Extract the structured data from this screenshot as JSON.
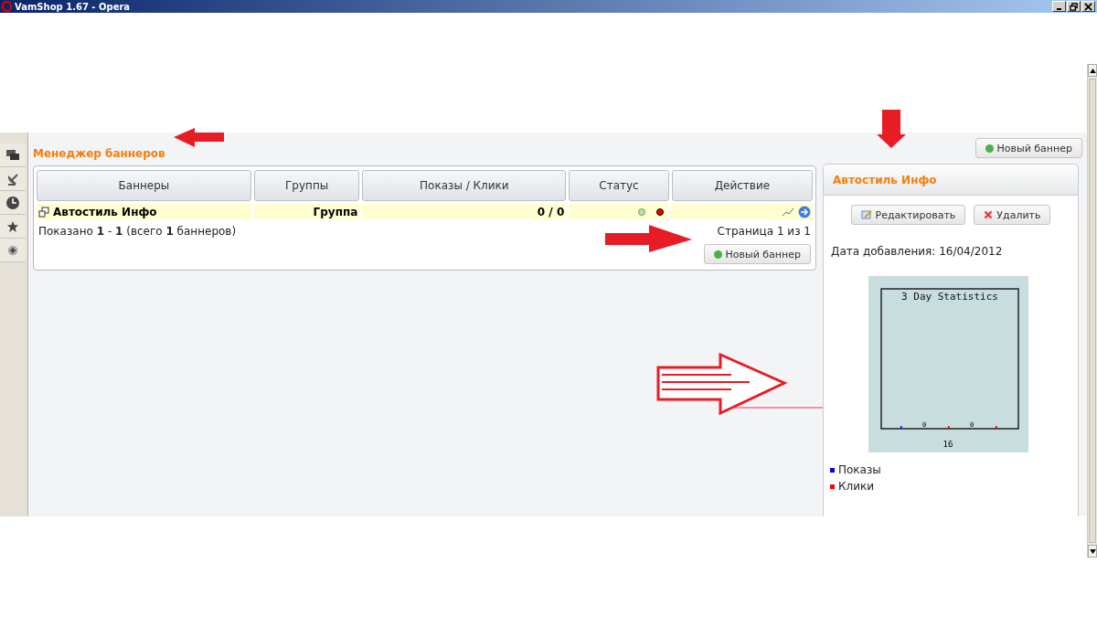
{
  "window": {
    "title": "VamShop 1.67 - Opera"
  },
  "page": {
    "title": "Менеджер баннеров",
    "new_button": "Новый баннер"
  },
  "table": {
    "columns": [
      "Баннеры",
      "Группы",
      "Показы / Клики",
      "Статус",
      "Действие"
    ],
    "rows": [
      {
        "name": "Автостиль Инфо",
        "group": "Группа",
        "stats": "0 / 0",
        "active": false
      }
    ],
    "summary": "Показано **1** - **1** (всего **1** баннеров)",
    "pagination": "Страница 1 из 1",
    "new_button": "Новый баннер"
  },
  "details": {
    "title": "Автостиль Инфо",
    "edit_button": "Редактировать",
    "delete_button": "Удалить",
    "date": "Дата добавления: 16/04/2012",
    "chart": {
      "title": "3 Day Statistics",
      "value_labels": [
        "0",
        "0"
      ],
      "axis_label": "16"
    },
    "legend": [
      {
        "name": "Показы",
        "color": "#0000ff"
      },
      {
        "name": "Клики",
        "color": "#ff0000"
      }
    ]
  }
}
